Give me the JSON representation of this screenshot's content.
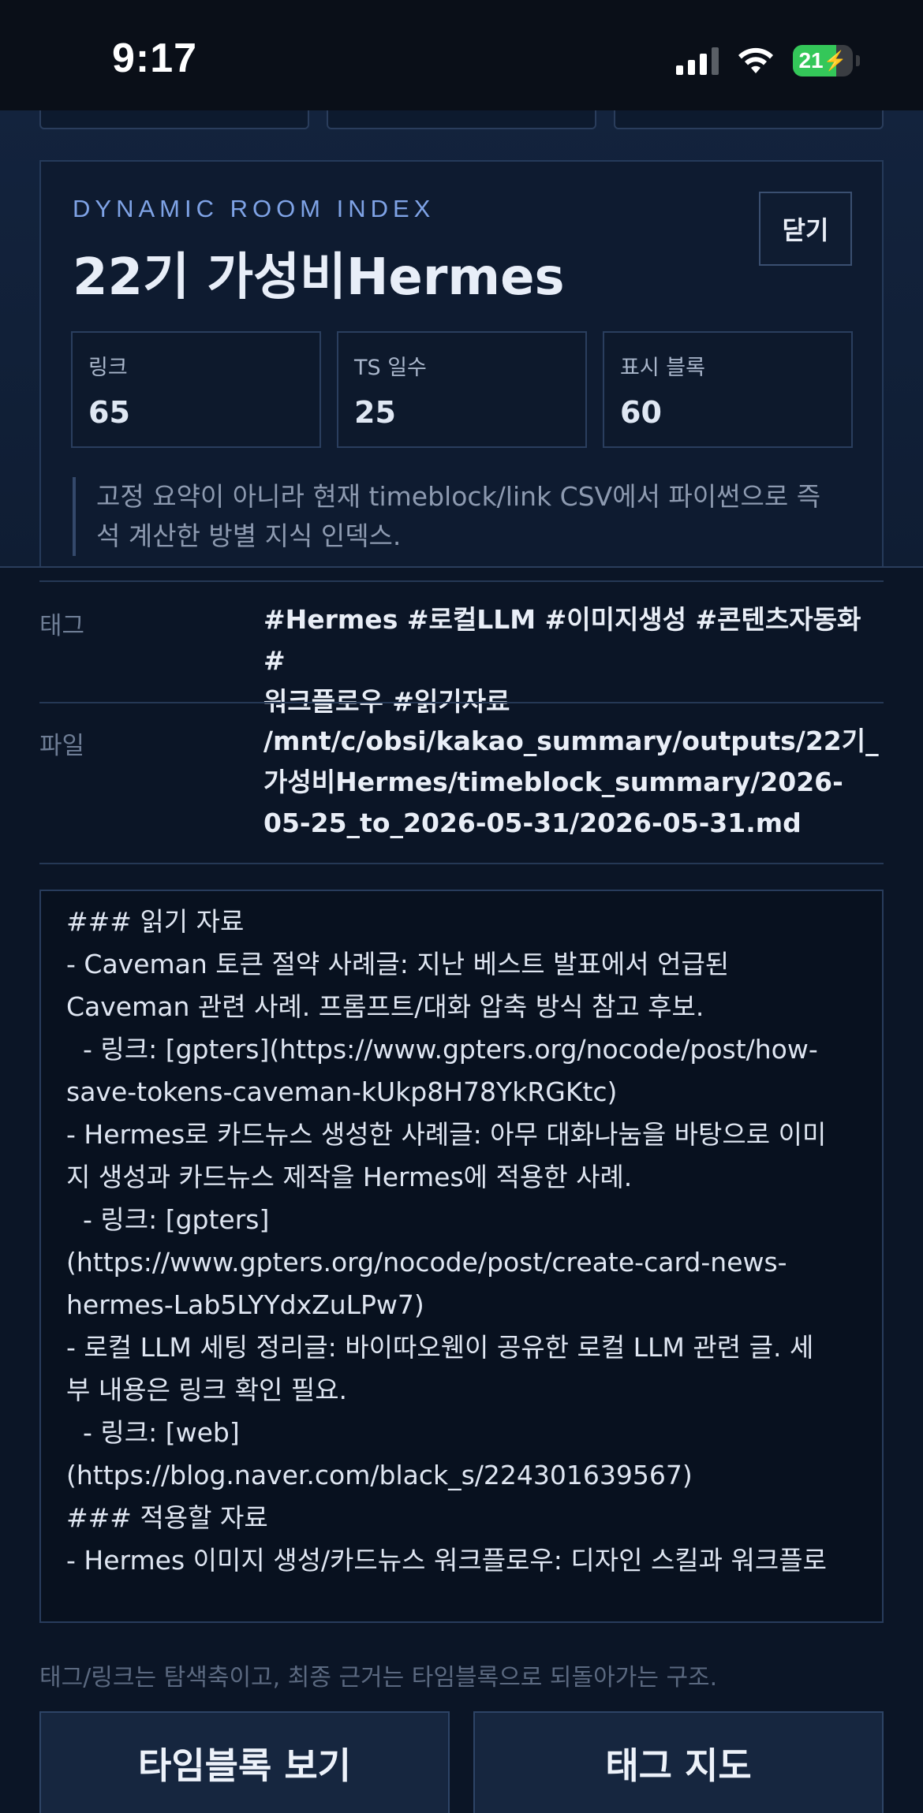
{
  "status_bar": {
    "time": "9:17",
    "battery_level": "21"
  },
  "room_index": {
    "kicker": "DYNAMIC ROOM INDEX",
    "title": "22기 가성비Hermes",
    "close_label": "닫기",
    "stats": [
      {
        "label": "링크",
        "value": "65"
      },
      {
        "label": "TS 일수",
        "value": "25"
      },
      {
        "label": "표시 블록",
        "value": "60"
      }
    ],
    "note_lines": [
      "고정 요약이 아니라 현재 timeblock/link CSV에서 파이썬으로 즉",
      "석 계산한 방별 지식 인덱스."
    ]
  },
  "detail": {
    "tags_label": "태그",
    "tags_lines": [
      "#Hermes #로컬LLM #이미지생성 #콘텐츠자동화 #",
      "워크플로우 #읽기자료"
    ],
    "file_label": "파일",
    "file_lines": [
      "/mnt/c/obsi/kakao_summary/outputs/22기_",
      "가성비Hermes/timeblock_summary/2026-",
      "05-25_to_2026-05-31/2026-05-31.md"
    ],
    "content_lines": [
      "### 읽기 자료",
      "- Caveman 토큰 절약 사례글: 지난 베스트 발표에서 언급된",
      "Caveman 관련 사례. 프롬프트/대화 압축 방식 참고 후보.",
      "  - 링크: [gpters](https://www.gpters.org/nocode/post/how-",
      "save-tokens-caveman-kUkp8H78YkRGKtc)",
      "- Hermes로 카드뉴스 생성한 사례글: 아무 대화나눔을 바탕으로 이미",
      "지 생성과 카드뉴스 제작을 Hermes에 적용한 사례.",
      "  - 링크: [gpters]",
      "(https://www.gpters.org/nocode/post/create-card-news-",
      "hermes-Lab5LYYdxZuLPw7)",
      "- 로컬 LLM 세팅 정리글: 바이따오웬이 공유한 로컬 LLM 관련 글. 세",
      "부 내용은 링크 확인 필요.",
      "  - 링크: [web]",
      "(https://blog.naver.com/black_s/224301639567)",
      "",
      "### 적용할 자료",
      "- Hermes 이미지 생성/카드뉴스 워크플로우: 디자인 스킬과 워크플로"
    ],
    "footer_note": "태그/링크는 탐색축이고, 최종 근거는 타임블록으로 되돌아가는 구조.",
    "actions": {
      "timeblock_label": "타임블록 보기",
      "tagmap_label": "태그 지도"
    }
  }
}
